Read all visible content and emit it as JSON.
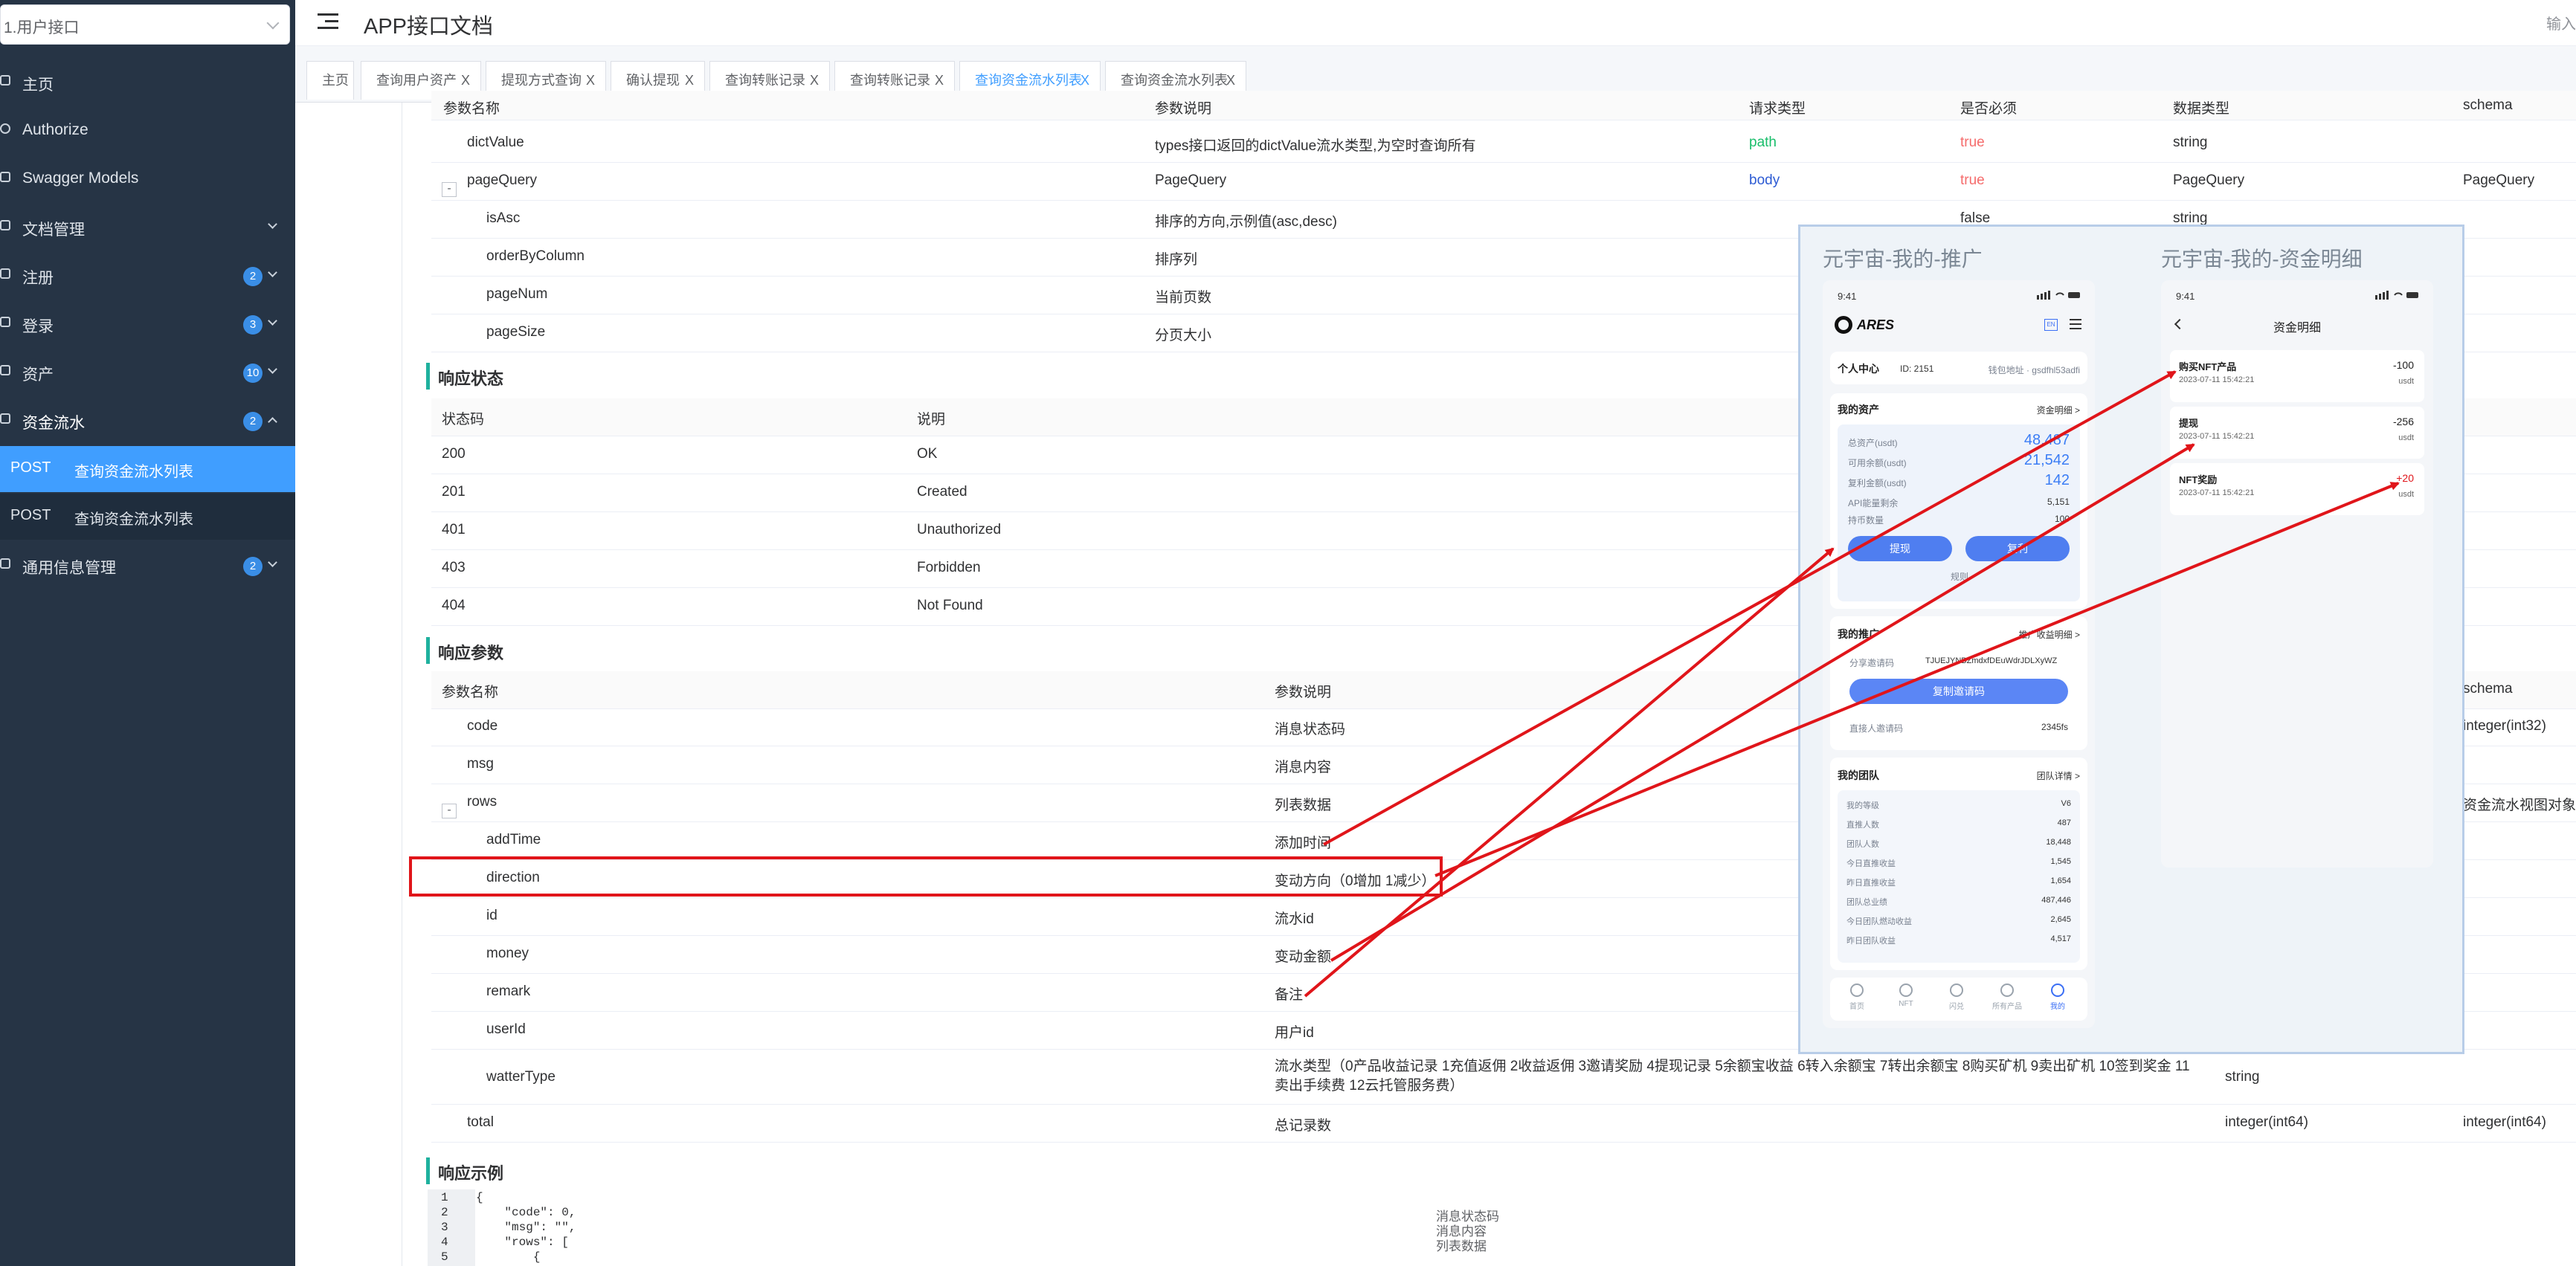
{
  "sidebar": {
    "select_value": "1.用户接口",
    "items": [
      {
        "label": "主页"
      },
      {
        "label": "Authorize"
      },
      {
        "label": "Swagger Models"
      },
      {
        "label": "文档管理"
      },
      {
        "label": "注册",
        "badge": "2"
      },
      {
        "label": "登录",
        "badge": "3"
      },
      {
        "label": "资产",
        "badge": "10"
      },
      {
        "label": "资金流水",
        "badge": "2"
      },
      {
        "label": "通用信息管理",
        "badge": "2"
      }
    ],
    "sub_items": [
      {
        "method": "POST",
        "label": "查询资金流水列表"
      },
      {
        "method": "POST",
        "label": "查询资金流水列表"
      }
    ]
  },
  "header": {
    "title": "APP接口文档",
    "right_text": "输入"
  },
  "tabs": [
    {
      "label": "主页",
      "closable": false
    },
    {
      "label": "查询用户资产",
      "closable": true
    },
    {
      "label": "提现方式查询",
      "closable": true
    },
    {
      "label": "确认提现",
      "closable": true
    },
    {
      "label": "查询转账记录",
      "closable": true
    },
    {
      "label": "查询转账记录",
      "closable": true
    },
    {
      "label": "查询资金流水列表",
      "closable": true,
      "active": true
    },
    {
      "label": "查询资金流水列表",
      "closable": true
    }
  ],
  "tab_close": "X",
  "req_params": {
    "header": [
      "参数名称",
      "参数说明",
      "请求类型",
      "是否必须",
      "数据类型",
      "schema"
    ],
    "rows": [
      {
        "name": "dictValue",
        "desc": "types接口返回的dictValue流水类型,为空时查询所有",
        "in": "path",
        "required": "true",
        "type": "string",
        "schema": ""
      },
      {
        "name": "pageQuery",
        "desc": "PageQuery",
        "in": "body",
        "required": "true",
        "type": "PageQuery",
        "schema": "PageQuery",
        "expand": "-"
      },
      {
        "name": "isAsc",
        "desc": "排序的方向,示例值(asc,desc)",
        "in": "",
        "required": "false",
        "type": "string",
        "schema": ""
      },
      {
        "name": "orderByColumn",
        "desc": "排序列",
        "in": "",
        "required": "",
        "type": "",
        "schema": ""
      },
      {
        "name": "pageNum",
        "desc": "当前页数",
        "in": "",
        "required": "",
        "type": "",
        "schema": ""
      },
      {
        "name": "pageSize",
        "desc": "分页大小",
        "in": "",
        "required": "",
        "type": "",
        "schema": ""
      }
    ]
  },
  "resp_status": {
    "title": "响应状态",
    "header": [
      "状态码",
      "说明"
    ],
    "rows": [
      {
        "code": "200",
        "desc": "OK"
      },
      {
        "code": "201",
        "desc": "Created"
      },
      {
        "code": "401",
        "desc": "Unauthorized"
      },
      {
        "code": "403",
        "desc": "Forbidden"
      },
      {
        "code": "404",
        "desc": "Not Found"
      }
    ]
  },
  "resp_params": {
    "title": "响应参数",
    "header": [
      "参数名称",
      "参数说明",
      "schema"
    ],
    "rows": [
      {
        "name": "code",
        "desc": "消息状态码",
        "type": "",
        "schema": "integer(int32)"
      },
      {
        "name": "msg",
        "desc": "消息内容",
        "type": "",
        "schema": ""
      },
      {
        "name": "rows",
        "desc": "列表数据",
        "type": "",
        "schema": "资金流水视图对象",
        "expand": "-"
      },
      {
        "name": "addTime",
        "desc": "添加时间",
        "type": "",
        "schema": ""
      },
      {
        "name": "direction",
        "desc": "变动方向（0增加 1减少）",
        "type": "",
        "schema": ""
      },
      {
        "name": "id",
        "desc": "流水id",
        "type": "",
        "schema": ""
      },
      {
        "name": "money",
        "desc": "变动金额",
        "type": "",
        "schema": ""
      },
      {
        "name": "remark",
        "desc": "备注",
        "type": "",
        "schema": ""
      },
      {
        "name": "userId",
        "desc": "用户id",
        "type": "",
        "schema": ""
      },
      {
        "name": "watterType",
        "desc": "流水类型（0产品收益记录 1充值返佣 2收益返佣 3邀请奖励 4提现记录 5余额宝收益 6转入余额宝 7转出余额宝 8购买矿机 9卖出矿机 10签到奖金 11卖出手续费 12云托管服务费）",
        "type": "string",
        "schema": ""
      },
      {
        "name": "total",
        "desc": "总记录数",
        "type": "integer(int64)",
        "schema": "integer(int64)"
      }
    ]
  },
  "resp_example": {
    "title": "响应示例",
    "lines": [
      {
        "no": "1",
        "text": "{",
        "comment": ""
      },
      {
        "no": "2",
        "text": "    \"code\": 0,",
        "comment": "消息状态码"
      },
      {
        "no": "3",
        "text": "    \"msg\": \"\",",
        "comment": "消息内容"
      },
      {
        "no": "4",
        "text": "    \"rows\": [",
        "comment": "列表数据"
      },
      {
        "no": "5",
        "text": "        {",
        "comment": ""
      }
    ]
  },
  "overlay": {
    "left_title": "元宇宙-我的-推广",
    "right_title": "元宇宙-我的-资金明细",
    "left_phone": {
      "time": "9:41",
      "brand": "ARES",
      "lang": "EN",
      "personal_center": "个人中心",
      "user_id": "ID: 2151",
      "wallet": "钱包地址 · gsdfhl53adfi",
      "assets_title": "我的资产",
      "assets_link": "资金明细 >",
      "assets": [
        {
          "label": "总资产(usdt)",
          "value": "48,487",
          "big": true
        },
        {
          "label": "可用余额(usdt)",
          "value": "21,542",
          "big": true
        },
        {
          "label": "复利金额(usdt)",
          "value": "142",
          "big": true
        },
        {
          "label": "API能量剩余",
          "value": "5,151"
        },
        {
          "label": "持币数量",
          "value": "100"
        }
      ],
      "btn_withdraw": "提现",
      "btn_compound": "复利",
      "rules": "规则",
      "promo_title": "我的推广",
      "promo_link": "推广收益明细 >",
      "share_label": "分享邀请码",
      "share_code": "TJUEJYNBZmdxfDEuWdrJDLXyWZ",
      "copy_btn": "复制邀请码",
      "invite_label": "直接人邀请码",
      "invite_value": "2345fs",
      "team_title": "我的团队",
      "team_link": "团队详情 >",
      "team_rows": [
        {
          "label": "我的等级",
          "value": "V6"
        },
        {
          "label": "直推人数",
          "value": "487"
        },
        {
          "label": "团队人数",
          "value": "18,448"
        },
        {
          "label": "今日直推收益",
          "value": "1,545"
        },
        {
          "label": "昨日直推收益",
          "value": "1,654"
        },
        {
          "label": "团队总业绩",
          "value": "487,446"
        },
        {
          "label": "今日团队燃动收益",
          "value": "2,645"
        },
        {
          "label": "昨日团队收益",
          "value": "4,517"
        }
      ],
      "bottom_nav": [
        "首页",
        "NFT",
        "闪兑",
        "所有产品",
        "我的"
      ]
    },
    "right_phone": {
      "time": "9:41",
      "title": "资金明细",
      "items": [
        {
          "name": "购买NFT产品",
          "date": "2023-07-11 15:42:21",
          "amount": "-100",
          "unit": "usdt"
        },
        {
          "name": "提现",
          "date": "2023-07-11 15:42:21",
          "amount": "-256",
          "unit": "usdt"
        },
        {
          "name": "NFT奖励",
          "date": "2023-07-11 15:42:21",
          "amount": "+20",
          "unit": "usdt"
        }
      ]
    }
  },
  "colors": {
    "sidebar_bg": "#263445",
    "active_blue": "#409eff",
    "annotation_red": "#e0151a",
    "section_bar": "#1fb19e"
  }
}
